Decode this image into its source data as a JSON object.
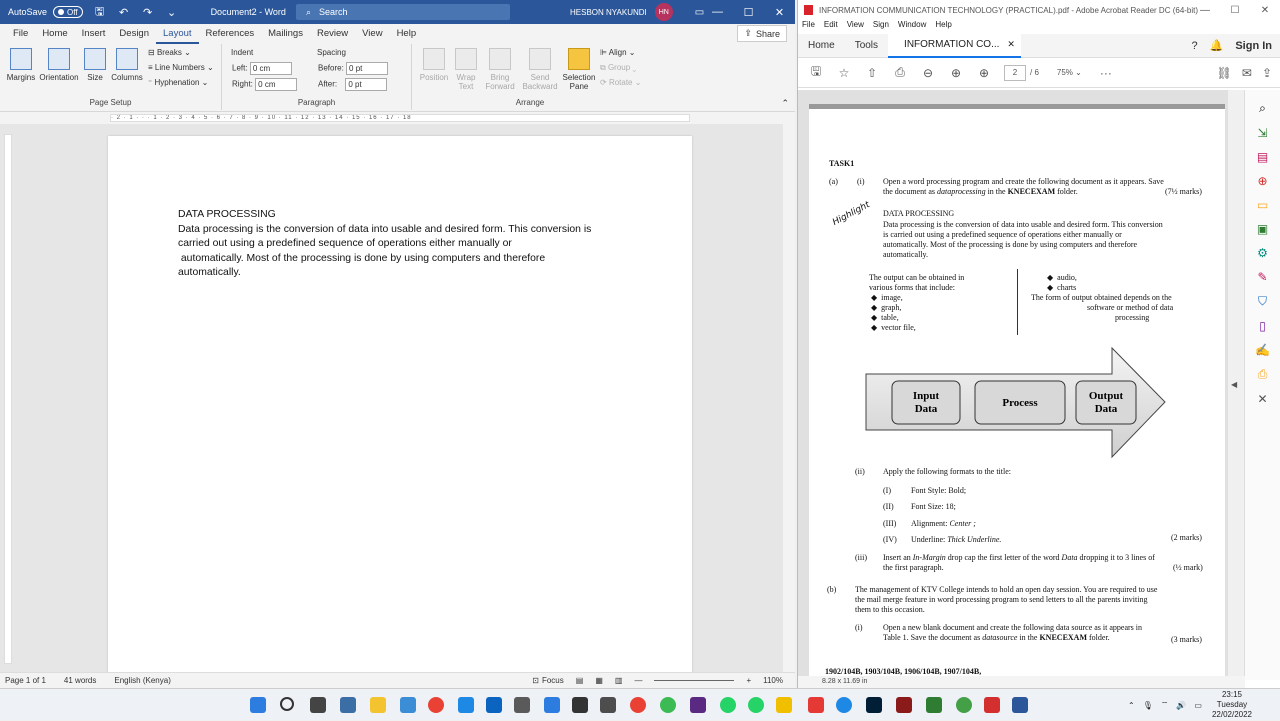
{
  "word": {
    "title": {
      "autosave": "AutoSave",
      "autosave_state": "Off",
      "doc": "Document2 - Word",
      "search": "Search",
      "user": "HESBON NYAKUNDI",
      "initials": "HN"
    },
    "tabs": [
      "File",
      "Home",
      "Insert",
      "Design",
      "Layout",
      "References",
      "Mailings",
      "Review",
      "View",
      "Help"
    ],
    "share": "Share",
    "ribbon": {
      "page_setup": {
        "margins": "Margins",
        "orientation": "Orientation",
        "size": "Size",
        "columns": "Columns",
        "breaks": "Breaks",
        "line_numbers": "Line Numbers",
        "hyphenation": "Hyphenation",
        "label": "Page Setup"
      },
      "paragraph": {
        "indent": "Indent",
        "spacing": "Spacing",
        "left": "Left:",
        "left_val": "0 cm",
        "right": "Right:",
        "right_val": "0 cm",
        "before": "Before:",
        "before_val": "0 pt",
        "after": "After:",
        "after_val": "0 pt",
        "label": "Paragraph"
      },
      "arrange": {
        "position": "Position",
        "wrap_text": "Wrap\nText",
        "bring_forward": "Bring\nForward",
        "send_backward": "Send\nBackward",
        "selection_pane": "Selection\nPane",
        "align": "Align",
        "group": "Group",
        "rotate": "Rotate",
        "label": "Arrange"
      }
    },
    "ruler_text": "· 2 · 1 · · · 1 · 2 · 3 · 4 · 5 · 6 · 7 · 8 · 9 · 10 · 11 · 12 · 13 · 14 · 15 · 16 · 17 · 18",
    "document": {
      "title": "DATA PROCESSING",
      "line1": "Data processing is the conversion of data into usable and desired form. This conversion is",
      "line2": "carried out using a predefined sequence of operations either manually or",
      "line3": " automatically. Most of the processing is done by using computers and therefore",
      "line4": "automatically."
    },
    "status": {
      "page": "Page 1 of 1",
      "words": "41 words",
      "language": "English (Kenya)",
      "focus": "Focus",
      "zoom": "110%"
    }
  },
  "acrobat": {
    "title": "INFORMATION COMMUNICATION TECHNOLOGY (PRACTICAL).pdf - Adobe Acrobat Reader DC (64-bit)",
    "menu": [
      "File",
      "Edit",
      "View",
      "Sign",
      "Window",
      "Help"
    ],
    "tabs": {
      "home": "Home",
      "tools": "Tools",
      "doc": "INFORMATION CO..."
    },
    "sign_in": "Sign In",
    "page_num": "2",
    "page_total": "/ 6",
    "zoom": "75%",
    "page_size": "8.28 x 11.69 in",
    "pdf": {
      "task": "TASK1",
      "a": "(a)",
      "a_i": "(i)",
      "a_i_text1": "Open a word processing program and create the following document as it appears. Save",
      "a_i_text2a": "the document as ",
      "a_i_text2b": "dataprocessing",
      "a_i_text2c": " in the ",
      "a_i_text2d": "KNECEXAM",
      "a_i_text2e": " folder.",
      "marks1": "(7½ marks)",
      "handwriting": "Highlight",
      "doc_title": "DATA PROCESSING",
      "doc_l1": "Data processing is the conversion of data into usable and desired form. This conversion",
      "doc_l2": "is carried out using a predefined sequence of operations either manually or",
      "doc_l3": "automatically. Most of the processing is done by using computers and therefore",
      "doc_l4": "automatically.",
      "col1": [
        "The output can be obtained in",
        "various forms that include:"
      ],
      "col1_items": [
        "image,",
        "graph,",
        "table,",
        "vector file,"
      ],
      "col2_items": [
        "audio,",
        "charts"
      ],
      "col2_text": [
        "The form of output obtained depends on the",
        "software or method of data",
        "processing"
      ],
      "arrow": [
        "Input\nData",
        "Process",
        "Output\nData"
      ],
      "ii": "(ii)",
      "ii_text": "Apply the following formats to the title:",
      "formats": [
        {
          "num": "(I)",
          "label": "Font Style: ",
          "val": "Bold;"
        },
        {
          "num": "(II)",
          "label": "Font Size: ",
          "val": "18;"
        },
        {
          "num": "(III)",
          "label": "Alignment: ",
          "val": "Center ;"
        },
        {
          "num": "(IV)",
          "label": "Underline: ",
          "val": "Thick Underline."
        }
      ],
      "marks2": "(2 marks)",
      "iii": "(iii)",
      "iii_text1a": "Insert an ",
      "iii_text1b": "In-Margin",
      "iii_text1c": " drop cap the first letter of the word ",
      "iii_text1d": "Data",
      "iii_text1e": " dropping it to 3 lines of",
      "iii_text2": "the first paragraph.",
      "marks3": "(½ mark)",
      "b": "(b)",
      "b_text": [
        "The management of KTV College intends to hold an open day session. You are required to use",
        "the mail merge feature in word processing program to send letters to all the parents inviting",
        "them to this occasion."
      ],
      "b_i": "(i)",
      "b_i_text1": "Open a new blank document and create the following data source as it appears in",
      "b_i_text2a": "Table 1. Save the document as ",
      "b_i_text2b": "datasource",
      "b_i_text2c": " in the ",
      "b_i_text2d": "KNECEXAM",
      "b_i_text2e": " folder.",
      "marks4": "(3 marks)",
      "footer": "1902/104B, 1903/104B, 1906/104B, 1907/104B,"
    }
  },
  "taskbar": {
    "time": "23:15",
    "day": "Tuesday",
    "date": "22/02/2022"
  }
}
